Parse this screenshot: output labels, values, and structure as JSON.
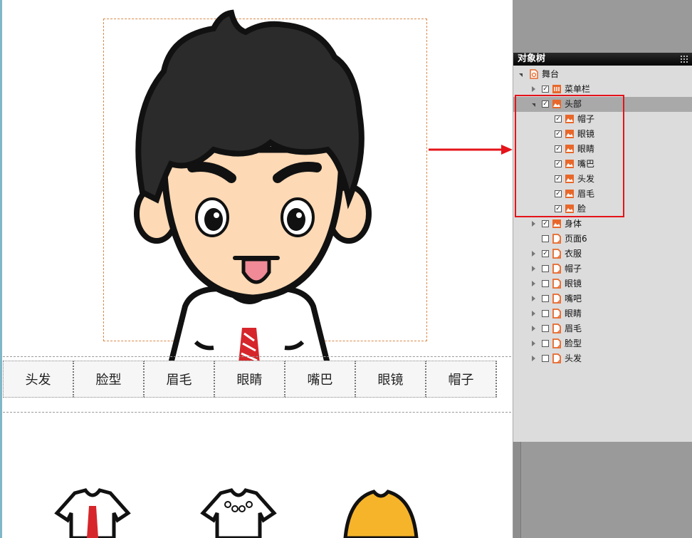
{
  "editor": {
    "tabs": [
      "头发",
      "脸型",
      "眉毛",
      "眼睛",
      "嘴巴",
      "眼镜",
      "帽子"
    ]
  },
  "panel": {
    "title": "对象树",
    "rows": [
      {
        "label": "舞台",
        "depth": 0,
        "toggle": "expanded",
        "checkbox": false,
        "checked": false,
        "icon": "stage-icon"
      },
      {
        "label": "菜单栏",
        "depth": 1,
        "toggle": "collapsed",
        "checkbox": true,
        "checked": true,
        "icon": "menu-icon"
      },
      {
        "label": "头部",
        "depth": 1,
        "toggle": "expanded",
        "checkbox": true,
        "checked": true,
        "icon": "image-icon",
        "selected": true
      },
      {
        "label": "帽子",
        "depth": 2,
        "toggle": "none",
        "checkbox": true,
        "checked": true,
        "icon": "image-icon"
      },
      {
        "label": "眼镜",
        "depth": 2,
        "toggle": "none",
        "checkbox": true,
        "checked": true,
        "icon": "image-icon"
      },
      {
        "label": "眼睛",
        "depth": 2,
        "toggle": "none",
        "checkbox": true,
        "checked": true,
        "icon": "image-icon"
      },
      {
        "label": "嘴巴",
        "depth": 2,
        "toggle": "none",
        "checkbox": true,
        "checked": true,
        "icon": "image-icon"
      },
      {
        "label": "头发",
        "depth": 2,
        "toggle": "none",
        "checkbox": true,
        "checked": true,
        "icon": "image-icon"
      },
      {
        "label": "眉毛",
        "depth": 2,
        "toggle": "none",
        "checkbox": true,
        "checked": true,
        "icon": "image-icon"
      },
      {
        "label": "脸",
        "depth": 2,
        "toggle": "none",
        "checkbox": true,
        "checked": true,
        "icon": "image-icon"
      },
      {
        "label": "身体",
        "depth": 1,
        "toggle": "collapsed",
        "checkbox": true,
        "checked": true,
        "icon": "image-icon"
      },
      {
        "label": "页面6",
        "depth": 1,
        "toggle": "none",
        "checkbox": true,
        "checked": false,
        "icon": "page-icon"
      },
      {
        "label": "衣服",
        "depth": 1,
        "toggle": "collapsed",
        "checkbox": true,
        "checked": true,
        "icon": "page-icon"
      },
      {
        "label": "帽子",
        "depth": 1,
        "toggle": "collapsed",
        "checkbox": true,
        "checked": false,
        "icon": "page-icon"
      },
      {
        "label": "眼镜",
        "depth": 1,
        "toggle": "collapsed",
        "checkbox": true,
        "checked": false,
        "icon": "page-icon"
      },
      {
        "label": "嘴吧",
        "depth": 1,
        "toggle": "collapsed",
        "checkbox": true,
        "checked": false,
        "icon": "page-icon"
      },
      {
        "label": "眼睛",
        "depth": 1,
        "toggle": "collapsed",
        "checkbox": true,
        "checked": false,
        "icon": "page-icon"
      },
      {
        "label": "眉毛",
        "depth": 1,
        "toggle": "collapsed",
        "checkbox": true,
        "checked": false,
        "icon": "page-icon"
      },
      {
        "label": "脸型",
        "depth": 1,
        "toggle": "collapsed",
        "checkbox": true,
        "checked": false,
        "icon": "page-icon"
      },
      {
        "label": "头发",
        "depth": 1,
        "toggle": "collapsed",
        "checkbox": true,
        "checked": false,
        "icon": "page-icon"
      }
    ]
  },
  "colors": {
    "accent": "#e8672a",
    "highlight": "#e4141a",
    "selected_row": "#a9a9a9"
  }
}
